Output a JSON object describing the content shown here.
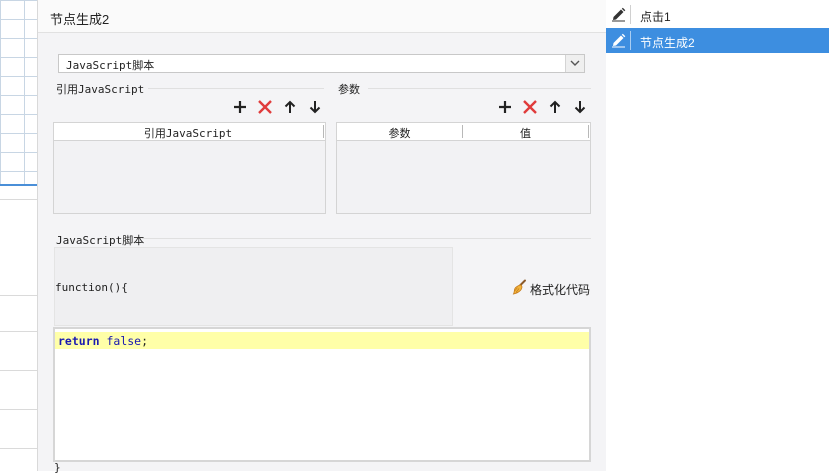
{
  "dialog": {
    "title": "节点生成2",
    "script_type": {
      "selected": "JavaScript脚本"
    },
    "ref_js": {
      "label": "引用JavaScript",
      "columns": [
        "引用JavaScript"
      ],
      "rows": []
    },
    "params": {
      "label": "参数",
      "columns": [
        "参数",
        "值"
      ],
      "rows": []
    },
    "toolbar_icons": [
      "plus-icon",
      "delete-icon",
      "arrow-up-icon",
      "arrow-down-icon"
    ],
    "script": {
      "label": "JavaScript脚本",
      "function_header": "function(){",
      "code_keyword_return": "return",
      "code_keyword_false": "false",
      "code_tail": ";",
      "function_footer": "}",
      "format_button": "格式化代码"
    }
  },
  "nodes": [
    {
      "label": "点击1",
      "selected": false
    },
    {
      "label": "节点生成2",
      "selected": true
    }
  ],
  "colors": {
    "accent": "#3d8ee0",
    "delete": "#e03b3b",
    "code_highlight": "#ffffa8",
    "keyword": "#1a1ab0"
  }
}
